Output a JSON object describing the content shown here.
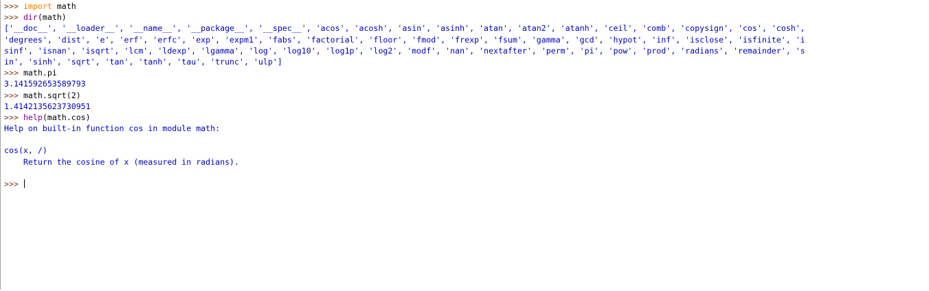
{
  "shell": {
    "prompt": ">>>",
    "entries": [
      {
        "type": "input",
        "parts": [
          {
            "kind": "kw",
            "text": "import"
          },
          {
            "kind": "code",
            "text": " math"
          }
        ]
      },
      {
        "type": "input",
        "parts": [
          {
            "kind": "builtin",
            "text": "dir"
          },
          {
            "kind": "code",
            "text": "(math)"
          }
        ]
      },
      {
        "type": "output",
        "text": "['__doc__', '__loader__', '__name__', '__package__', '__spec__', 'acos', 'acosh', 'asin', 'asinh', 'atan', 'atan2', 'atanh', 'ceil', 'comb', 'copysign', 'cos', 'cosh',"
      },
      {
        "type": "output",
        "text": "'degrees', 'dist', 'e', 'erf', 'erfc', 'exp', 'expm1', 'fabs', 'factorial', 'floor', 'fmod', 'frexp', 'fsum', 'gamma', 'gcd', 'hypot', 'inf', 'isclose', 'isfinite', 'i"
      },
      {
        "type": "output",
        "text": "sinf', 'isnan', 'isqrt', 'lcm', 'ldexp', 'lgamma', 'log', 'log10', 'log1p', 'log2', 'modf', 'nan', 'nextafter', 'perm', 'pi', 'pow', 'prod', 'radians', 'remainder', 's"
      },
      {
        "type": "output",
        "text": "in', 'sinh', 'sqrt', 'tan', 'tanh', 'tau', 'trunc', 'ulp']"
      },
      {
        "type": "input",
        "parts": [
          {
            "kind": "code",
            "text": "math.pi"
          }
        ]
      },
      {
        "type": "output",
        "text": "3.141592653589793"
      },
      {
        "type": "input",
        "parts": [
          {
            "kind": "code",
            "text": "math.sqrt(2)"
          }
        ]
      },
      {
        "type": "output",
        "text": "1.4142135623730951"
      },
      {
        "type": "input",
        "parts": [
          {
            "kind": "builtin",
            "text": "help"
          },
          {
            "kind": "code",
            "text": "(math.cos)"
          }
        ]
      },
      {
        "type": "output",
        "text": "Help on built-in function cos in module math:"
      },
      {
        "type": "output",
        "text": ""
      },
      {
        "type": "output",
        "text": "cos(x, /)"
      },
      {
        "type": "output",
        "text": "    Return the cosine of x (measured in radians)."
      },
      {
        "type": "output",
        "text": ""
      },
      {
        "type": "input",
        "parts": []
      }
    ]
  },
  "colors": {
    "prompt": "#7f3a1a",
    "keyword": "#ff7700",
    "builtin": "#900090",
    "output": "#0000c0",
    "background": "#ffffff"
  }
}
